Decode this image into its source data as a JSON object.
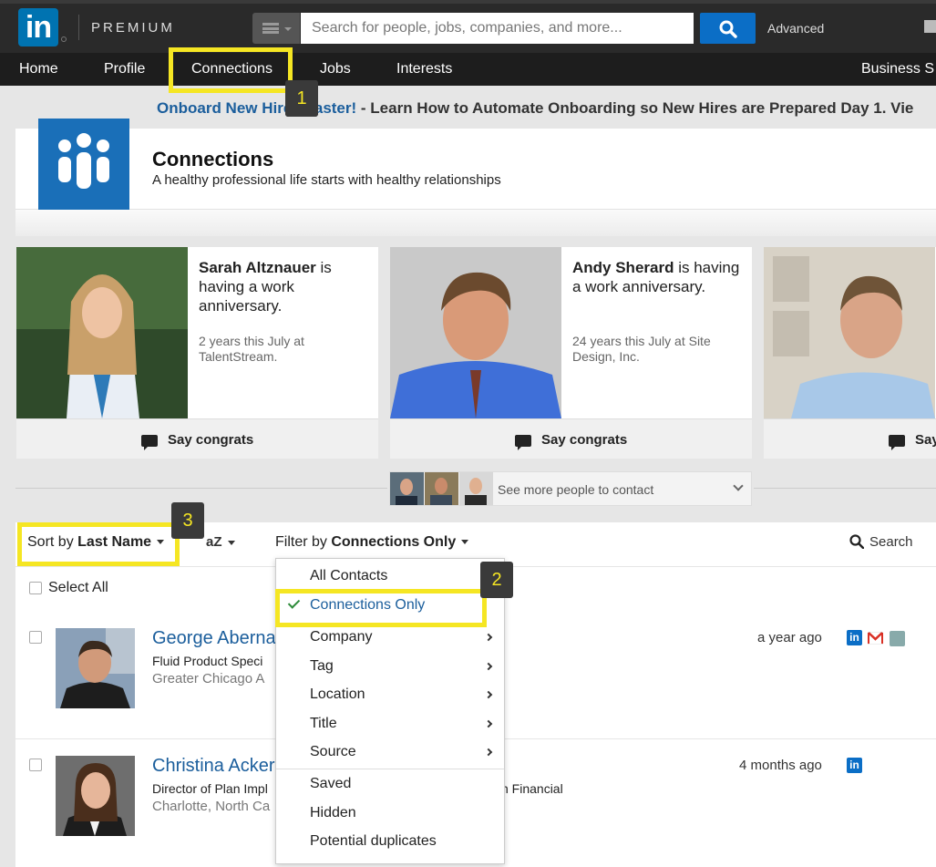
{
  "brand": {
    "logo_text": "in",
    "premium_label": "PREMIUM"
  },
  "search": {
    "placeholder": "Search for people, jobs, companies, and more...",
    "advanced_label": "Advanced"
  },
  "nav": {
    "items": [
      "Home",
      "Profile",
      "Connections",
      "Jobs",
      "Interests"
    ],
    "business": "Business S"
  },
  "steps": [
    "1",
    "2",
    "3"
  ],
  "ad": {
    "link": "Onboard New Hires Faster!",
    "rest": " - Learn How to Automate Onboarding so New Hires are Prepared Day 1. Vie"
  },
  "header": {
    "title": "Connections",
    "subtitle": "A healthy professional life starts with healthy relationships"
  },
  "anniversaries": [
    {
      "name": "Sarah Altznauer",
      "suffix": " is having a work anniversary.",
      "detail": "2 years this July at TalentStream.",
      "action": "Say congrats"
    },
    {
      "name": "Andy Sherard",
      "suffix": " is having a work anniversary.",
      "detail": "24 years this July at Site Design, Inc.",
      "action": "Say congrats"
    },
    {
      "name": "",
      "suffix": "",
      "detail": "",
      "action": "Say"
    }
  ],
  "more_people": "See more people to contact",
  "toolbar": {
    "sort_prefix": "Sort by ",
    "sort_value": "Last Name",
    "order": "aZ",
    "filter_prefix": "Filter by ",
    "filter_value": "Connections Only",
    "search_label": "Search"
  },
  "select_all": "Select All",
  "contacts": [
    {
      "name": "George Aberna",
      "title": "Fluid Product Speci",
      "location": "Greater Chicago A",
      "time": "a year ago"
    },
    {
      "name": "Christina Acker",
      "title": "Director of Plan Impl",
      "title_right": "n Financial",
      "location": "Charlotte, North Ca",
      "time": "4 months ago"
    }
  ],
  "dropdown": {
    "items": [
      "All Contacts",
      "Connections Only",
      "Company",
      "Tag",
      "Location",
      "Title",
      "Source",
      "Saved",
      "Hidden",
      "Potential duplicates"
    ],
    "selected": "Connections Only"
  },
  "colors": {
    "brand_blue": "#0073b1",
    "highlight_yellow": "#f5e623",
    "link_blue": "#1b5e9c"
  }
}
